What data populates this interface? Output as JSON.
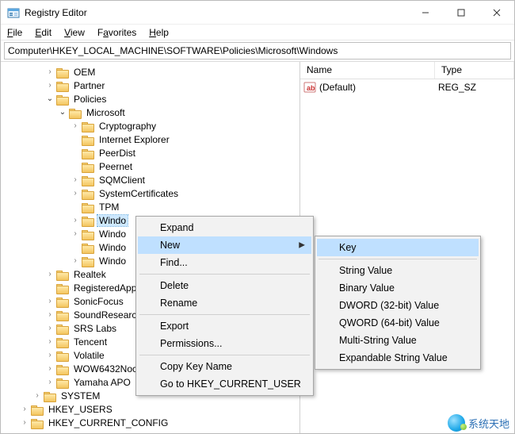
{
  "window": {
    "title": "Registry Editor"
  },
  "menu": {
    "file": "File",
    "edit": "Edit",
    "view": "View",
    "favorites": "Favorites",
    "help": "Help"
  },
  "address": "Computer\\HKEY_LOCAL_MACHINE\\SOFTWARE\\Policies\\Microsoft\\Windows",
  "columns": {
    "name": "Name",
    "type": "Type"
  },
  "values": [
    {
      "name": "(Default)",
      "type": "REG_SZ"
    }
  ],
  "tree": {
    "oem": "OEM",
    "partner": "Partner",
    "policies": "Policies",
    "microsoft": "Microsoft",
    "cryptography": "Cryptography",
    "ie": "Internet Explorer",
    "peerdist": "PeerDist",
    "peernet": "Peernet",
    "sqmclient": "SQMClient",
    "systemcertificates": "SystemCertificates",
    "tpm": "TPM",
    "windo1": "Windo",
    "windo2": "Windo",
    "windo3": "Windo",
    "windo4": "Windo",
    "realtek": "Realtek",
    "registeredapp": "RegisteredApp",
    "sonicfocus": "SonicFocus",
    "soundresearch": "SoundResearch",
    "srslabs": "SRS Labs",
    "tencent": "Tencent",
    "volatile": "Volatile",
    "wow6432": "WOW6432Noc",
    "yamaha": "Yamaha APO",
    "system": "SYSTEM",
    "hkusers": "HKEY_USERS",
    "hkcc": "HKEY_CURRENT_CONFIG"
  },
  "context_menu": {
    "expand": "Expand",
    "new": "New",
    "find": "Find...",
    "delete": "Delete",
    "rename": "Rename",
    "export": "Export",
    "permissions": "Permissions...",
    "copy_key_name": "Copy Key Name",
    "goto_hkcu": "Go to HKEY_CURRENT_USER"
  },
  "new_submenu": {
    "key": "Key",
    "string": "String Value",
    "binary": "Binary Value",
    "dword": "DWORD (32-bit) Value",
    "qword": "QWORD (64-bit) Value",
    "multi": "Multi-String Value",
    "expand": "Expandable String Value"
  },
  "watermark": "系统天地"
}
